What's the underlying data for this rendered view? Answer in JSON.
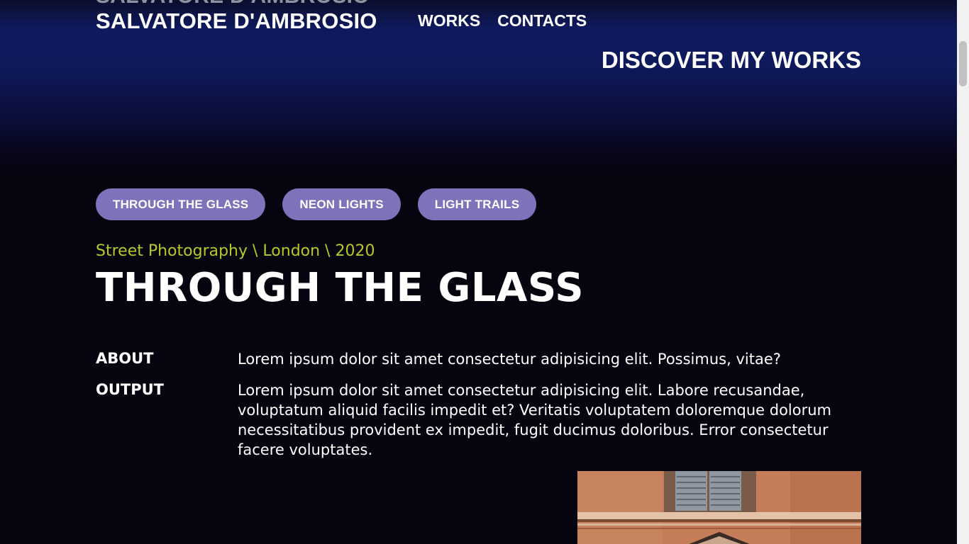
{
  "header": {
    "site_title": "SALVATORE D'AMBROSIO",
    "nav": [
      {
        "label": "WORKS"
      },
      {
        "label": "CONTACTS"
      }
    ],
    "discover_link": "DISCOVER MY WORKS"
  },
  "project_tabs": [
    {
      "label": "THROUGH THE GLASS"
    },
    {
      "label": "NEON LIGHTS"
    },
    {
      "label": "LIGHT TRAILS"
    }
  ],
  "project": {
    "meta": "Street Photography \\ London \\ 2020",
    "title": "THROUGH THE GLASS",
    "about_label": "ABOUT",
    "about_text": "Lorem ipsum dolor sit amet consectetur adipisicing elit. Possimus, vitae?",
    "output_label": "OUTPUT",
    "output_text": "Lorem ipsum dolor sit amet consectetur adipisicing elit. Labore recusandae, voluptatum aliquid facilis impedit et? Veritatis voluptatem doloremque dolorum necessitatibus provident ex impedit, fugit ducimus doloribus. Error consectetur facere voluptates."
  },
  "colors": {
    "accent_pill": "#8071bb",
    "meta_text": "#b7c92a",
    "background": "#06040f",
    "header_blue": "#0f1a5e"
  }
}
